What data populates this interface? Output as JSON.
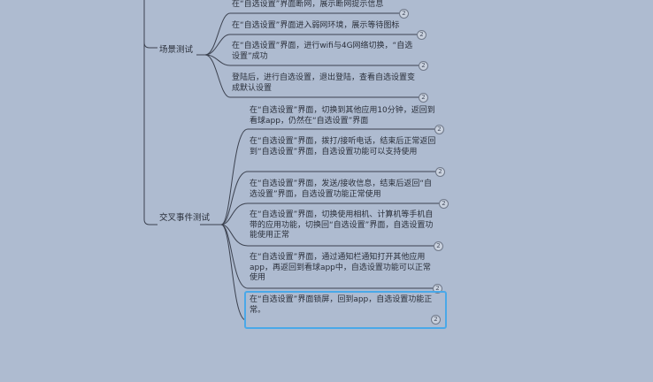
{
  "branches": {
    "scene": "场景测试",
    "cross": "交叉事件测试"
  },
  "scene_nodes": [
    "在“自选设置”界面断网，展示断网提示信息",
    "在“自选设置”界面进入弱网环境，展示等待图标",
    "在“自选设置”界面，进行wifi与4G网络切换，“自选设置”成功",
    "登陆后，进行自选设置，退出登陆，查看自选设置变成默认设置"
  ],
  "cross_nodes": [
    "在“自选设置”界面，切换到其他应用10分钟，返回到看球app，仍然在“自选设置”界面",
    "在“自选设置”界面，拨打/接听电话，结束后正常返回到“自选设置”界面，自选设置功能可以支持使用",
    "在“自选设置”界面，发送/接收信息，结束后返回“自选设置”界面，自选设置功能正常使用",
    "在“自选设置”界面，切换使用相机、计算机等手机自带的应用功能，切换回“自选设置”界面，自选设置功能使用正常",
    "在“自选设置”界面，通过通知栏通知打开其他应用app，再返回到看球app中，自选设置功能可以正常使用",
    "在“自选设置”界面锁屏，回到app，自选设置功能正常。"
  ],
  "badge": "2",
  "colors": {
    "background": "#aebbd0",
    "line": "#3c4250",
    "selection": "#4aa8e8"
  }
}
